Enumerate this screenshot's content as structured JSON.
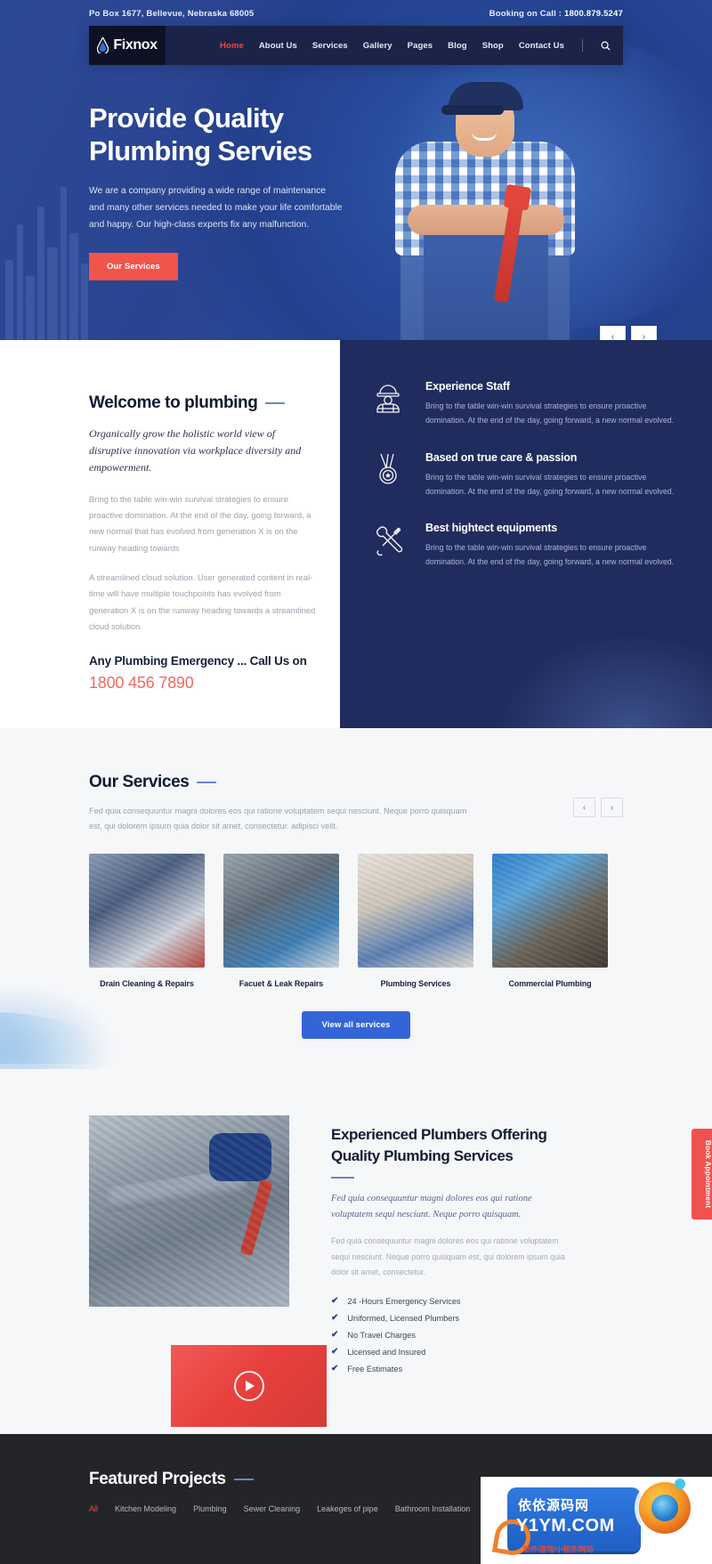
{
  "topbar": {
    "address": "Po Box 1677, Bellevue, Nebraska 68005",
    "booking_label": "Booking on Call :",
    "phone": "1800.879.5247"
  },
  "brand": {
    "name": "Fixnox",
    "logo_icon": "water-drop-icon"
  },
  "nav": {
    "items": [
      {
        "label": "Home",
        "active": true
      },
      {
        "label": "About Us",
        "active": false
      },
      {
        "label": "Services",
        "active": false
      },
      {
        "label": "Gallery",
        "active": false
      },
      {
        "label": "Pages",
        "active": false
      },
      {
        "label": "Blog",
        "active": false
      },
      {
        "label": "Shop",
        "active": false
      },
      {
        "label": "Contact Us",
        "active": false
      }
    ],
    "search_icon": "search-icon"
  },
  "hero": {
    "title_line1": "Provide Quality",
    "title_line2": "Plumbing Servies",
    "paragraph": "We are a company providing a wide range of maintenance and many other services needed to make your life comfortable and happy. Our high-class experts fix any malfunction.",
    "cta": "Our Services",
    "prev_icon": "chevron-left-icon",
    "next_icon": "chevron-right-icon"
  },
  "welcome": {
    "heading": "Welcome to plumbing",
    "lead": "Organically grow the holistic world view of disruptive innovation via workplace diversity and empowerment.",
    "para1": "Bring to the table win-win survival strategies to ensure proactive domination. At the end of the day, going forward, a new normal that has evolved from generation X is on the runway heading towards",
    "para2": "A streamlined cloud solution. User generated content in real-time will have multiple touchpoints has evolved from generation X is on the runway heading towards a streamlined cloud solution.",
    "emergency_label": "Any Plumbing Emergency ... Call Us on",
    "emergency_phone": "1800 456 7890"
  },
  "features": [
    {
      "icon": "worker-helmet-icon",
      "title": "Experience Staff",
      "text": "Bring to the table win-win survival strategies to ensure proactive domination. At the end of the day, going forward, a new normal evolved."
    },
    {
      "icon": "medal-icon",
      "title": "Based on true care & passion",
      "text": "Bring to the table win-win survival strategies to ensure proactive domination. At the end of the day, going forward, a new normal evolved."
    },
    {
      "icon": "wrench-screwdriver-icon",
      "title": "Best hightect equipments",
      "text": "Bring to the table win-win survival strategies to ensure proactive domination. At the end of the day, going forward, a new normal evolved."
    }
  ],
  "services": {
    "title": "Our Services",
    "subtitle": "Fed quia consequuntur magni dolores eos qui ratione voluptatem sequi nesciunt. Neque porro quisquam est, qui dolorem ipsum quia dolor sit amet, consectetur. adipisci velit.",
    "prev_icon": "chevron-left-icon",
    "next_icon": "chevron-right-icon",
    "cards": [
      {
        "caption": "Drain Cleaning & Repairs"
      },
      {
        "caption": "Facuet & Leak Repairs"
      },
      {
        "caption": "Plumbing Services"
      },
      {
        "caption": "Commercial Plumbing"
      }
    ],
    "view_all": "View all services"
  },
  "experienced": {
    "heading_line1": "Experienced Plumbers Offering",
    "heading_line2": "Quality Plumbing Services",
    "lead": "Fed quia consequuntur magni dolores eos qui ratione voluptatem sequi nesciunt. Neque porro quisquam.",
    "paragraph": "Fed quia consequuntur magni dolores eos qui ratione voluptatem sequi nesciunt. Neque porro quisquam est, qui dolorem ipsum quia dolor sit amet, consectetur.",
    "play_icon": "play-icon",
    "checklist": [
      "24 -Hours Emergency Services",
      "Uniformed, Licensed Plumbers",
      "No Travel Charges",
      "Licensed and Insured",
      "Free Estimates"
    ]
  },
  "book_tab": {
    "label": "Book Appointment"
  },
  "featured": {
    "title": "Featured Projects",
    "filters": [
      {
        "label": "All",
        "active": true
      },
      {
        "label": "Kitchen Modeling",
        "active": false
      },
      {
        "label": "Plumbing",
        "active": false
      },
      {
        "label": "Sewer Cleaning",
        "active": false
      },
      {
        "label": "Leakeges of pipe",
        "active": false
      },
      {
        "label": "Bathroom Installation",
        "active": false
      }
    ]
  },
  "watermark": {
    "line1": "依依源码网",
    "line2": "Y1YM.COM",
    "line3": "软件/游戏/小程序/网站"
  },
  "colors": {
    "hero_blue": "#2a4490",
    "panel_navy": "#212c5e",
    "accent_red": "#f1544b",
    "accent_blue": "#3465d8",
    "dark_footer": "#242529"
  }
}
